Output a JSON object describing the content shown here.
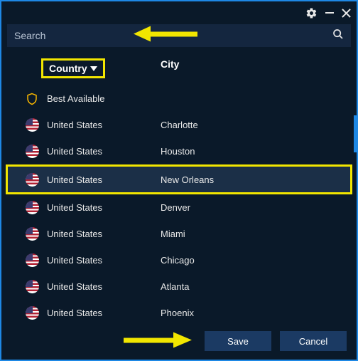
{
  "titlebar": {
    "settings_icon": "gear",
    "minimize_icon": "minimize",
    "close_icon": "close"
  },
  "search": {
    "placeholder": "Search"
  },
  "headers": {
    "country": "Country",
    "city": "City"
  },
  "rows": [
    {
      "flag": "shield",
      "country": "Best Available",
      "city": "",
      "selected": false
    },
    {
      "flag": "us",
      "country": "United States",
      "city": "Charlotte",
      "selected": false
    },
    {
      "flag": "us",
      "country": "United States",
      "city": "Houston",
      "selected": false
    },
    {
      "flag": "us",
      "country": "United States",
      "city": "New Orleans",
      "selected": true
    },
    {
      "flag": "us",
      "country": "United States",
      "city": "Denver",
      "selected": false
    },
    {
      "flag": "us",
      "country": "United States",
      "city": "Miami",
      "selected": false
    },
    {
      "flag": "us",
      "country": "United States",
      "city": "Chicago",
      "selected": false
    },
    {
      "flag": "us",
      "country": "United States",
      "city": "Atlanta",
      "selected": false
    },
    {
      "flag": "us",
      "country": "United States",
      "city": "Phoenix",
      "selected": false
    }
  ],
  "footer": {
    "save": "Save",
    "cancel": "Cancel"
  },
  "annotations": {
    "highlight_color": "#f2e600"
  }
}
